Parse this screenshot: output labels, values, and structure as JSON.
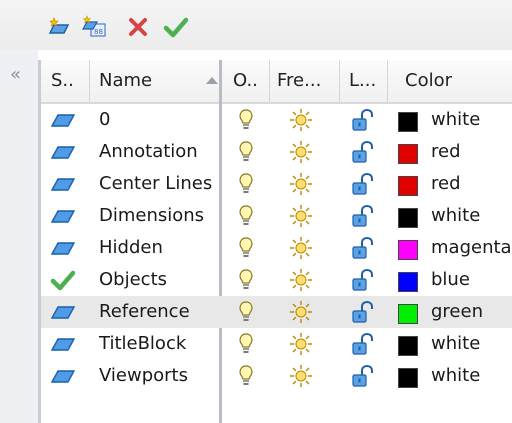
{
  "headers": {
    "status": "S..",
    "name": "Name",
    "on": "O..",
    "freeze": "Fre...",
    "lock": "L...",
    "color": "Color"
  },
  "rows": [
    {
      "status": "layer",
      "name": "0",
      "color_name": "white",
      "color": "#000000"
    },
    {
      "status": "layer",
      "name": "Annotation",
      "color_name": "red",
      "color": "#e00000"
    },
    {
      "status": "layer",
      "name": "Center Lines",
      "color_name": "red",
      "color": "#e00000"
    },
    {
      "status": "layer",
      "name": "Dimensions",
      "color_name": "white",
      "color": "#000000"
    },
    {
      "status": "layer",
      "name": "Hidden",
      "color_name": "magenta",
      "color": "#ff00ff"
    },
    {
      "status": "current",
      "name": "Objects",
      "color_name": "blue",
      "color": "#0000ff"
    },
    {
      "status": "layer",
      "name": "Reference",
      "color_name": "green",
      "color": "#00ee00"
    },
    {
      "status": "layer",
      "name": "TitleBlock",
      "color_name": "white",
      "color": "#000000"
    },
    {
      "status": "layer",
      "name": "Viewports",
      "color_name": "white",
      "color": "#000000"
    }
  ],
  "selected_row": 6,
  "icons": {
    "toolbar": [
      "new-layer-icon",
      "new-layer-vp-frozen-icon",
      "delete-layer-icon",
      "set-current-icon"
    ],
    "on": "lightbulb-icon",
    "freeze": "sun-icon",
    "lock": "unlock-icon"
  },
  "colors": {
    "accent_blue": "#1f6fd1",
    "check_green": "#4caf50",
    "delete_red": "#d64545"
  }
}
